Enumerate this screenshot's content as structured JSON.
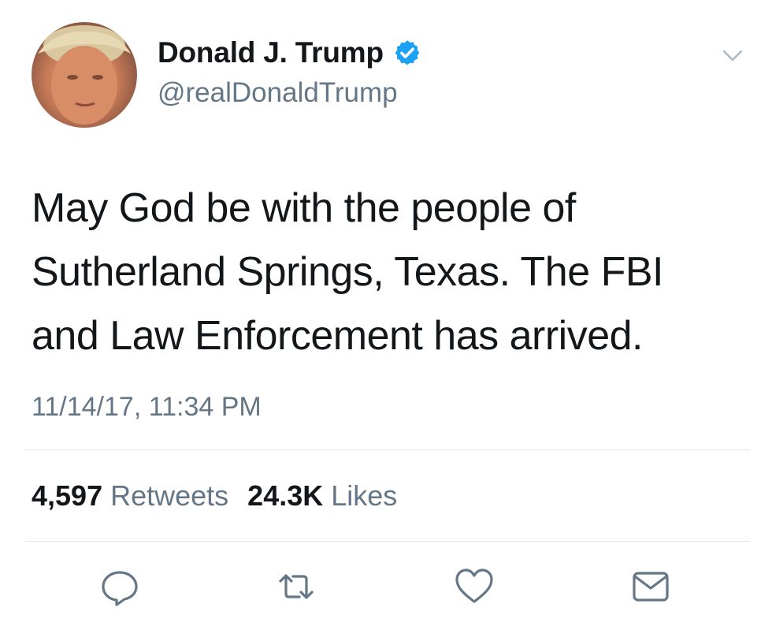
{
  "tweet": {
    "author": {
      "display_name": "Donald J. Trump",
      "handle": "@realDonaldTrump",
      "verified": true,
      "verified_color": "#1da1f2"
    },
    "text": "May God be with the people of\nSutherland Springs, Texas. The FBI\nand Law Enforcement has arrived.",
    "timestamp": "11/14/17, 11:34 PM",
    "stats": {
      "retweets_count": "4,597",
      "retweets_label": "Retweets",
      "likes_count": "24.3K",
      "likes_label": "Likes"
    },
    "actions": [
      "reply-icon",
      "retweet-icon",
      "like-icon",
      "direct-message-icon"
    ]
  },
  "colors": {
    "text_primary": "#14171a",
    "text_secondary": "#657786",
    "divider": "#e1e8ed",
    "accent": "#1da1f2"
  }
}
